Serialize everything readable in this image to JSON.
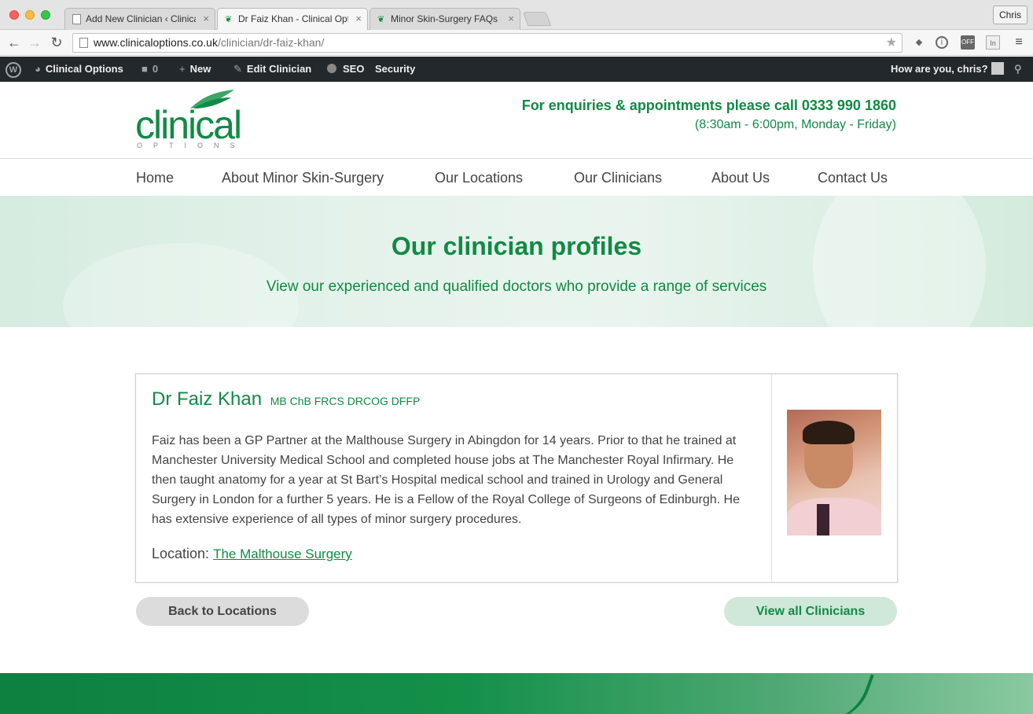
{
  "browser": {
    "tabs": [
      {
        "label": "Add New Clinician ‹ Clinica"
      },
      {
        "label": "Dr Faiz Khan - Clinical Opt"
      },
      {
        "label": "Minor Skin-Surgery FAQs -"
      }
    ],
    "profile": "Chris",
    "url_host": "www.clinicaloptions.co.uk",
    "url_path": "/clinician/dr-faiz-khan/"
  },
  "admin_bar": {
    "site_name": "Clinical Options",
    "comments_count": "0",
    "new_label": "New",
    "edit_label": "Edit Clinician",
    "seo_label": "SEO",
    "security_label": "Security",
    "greeting": "How are you, chris?"
  },
  "header": {
    "logo_word": "clinical",
    "logo_sub": "OPTIONS",
    "contact": "For enquiries & appointments please call 0333 990 1860",
    "hours": "(8:30am - 6:00pm, Monday - Friday)"
  },
  "nav": {
    "items": [
      {
        "label": "Home"
      },
      {
        "label": "About Minor Skin-Surgery"
      },
      {
        "label": "Our Locations"
      },
      {
        "label": "Our Clinicians"
      },
      {
        "label": "About Us"
      },
      {
        "label": "Contact Us"
      }
    ]
  },
  "hero": {
    "title": "Our clinician profiles",
    "subtitle": "View our experienced and qualified doctors who provide a range of services"
  },
  "clinician": {
    "name": "Dr Faiz Khan",
    "qualifications": "MB ChB FRCS DRCOG DFFP",
    "bio": "Faiz has been a GP Partner at the Malthouse Surgery in Abingdon for 14 years. Prior to that he trained at Manchester University Medical School and completed house jobs at The Manchester Royal Infirmary. He then taught anatomy for a year at St Bart’s Hospital medical school and trained in Urology and General Surgery in London for a further 5 years. He is a Fellow of the Royal College of Surgeons of Edinburgh. He has extensive experience of all types of minor surgery procedures.",
    "location_label": "Location:",
    "location_link": "The Malthouse Surgery"
  },
  "actions": {
    "back": "Back to Locations",
    "view_all": "View all Clinicians"
  },
  "colors": {
    "brand_green": "#118a45",
    "admin_bar": "#23282d"
  }
}
